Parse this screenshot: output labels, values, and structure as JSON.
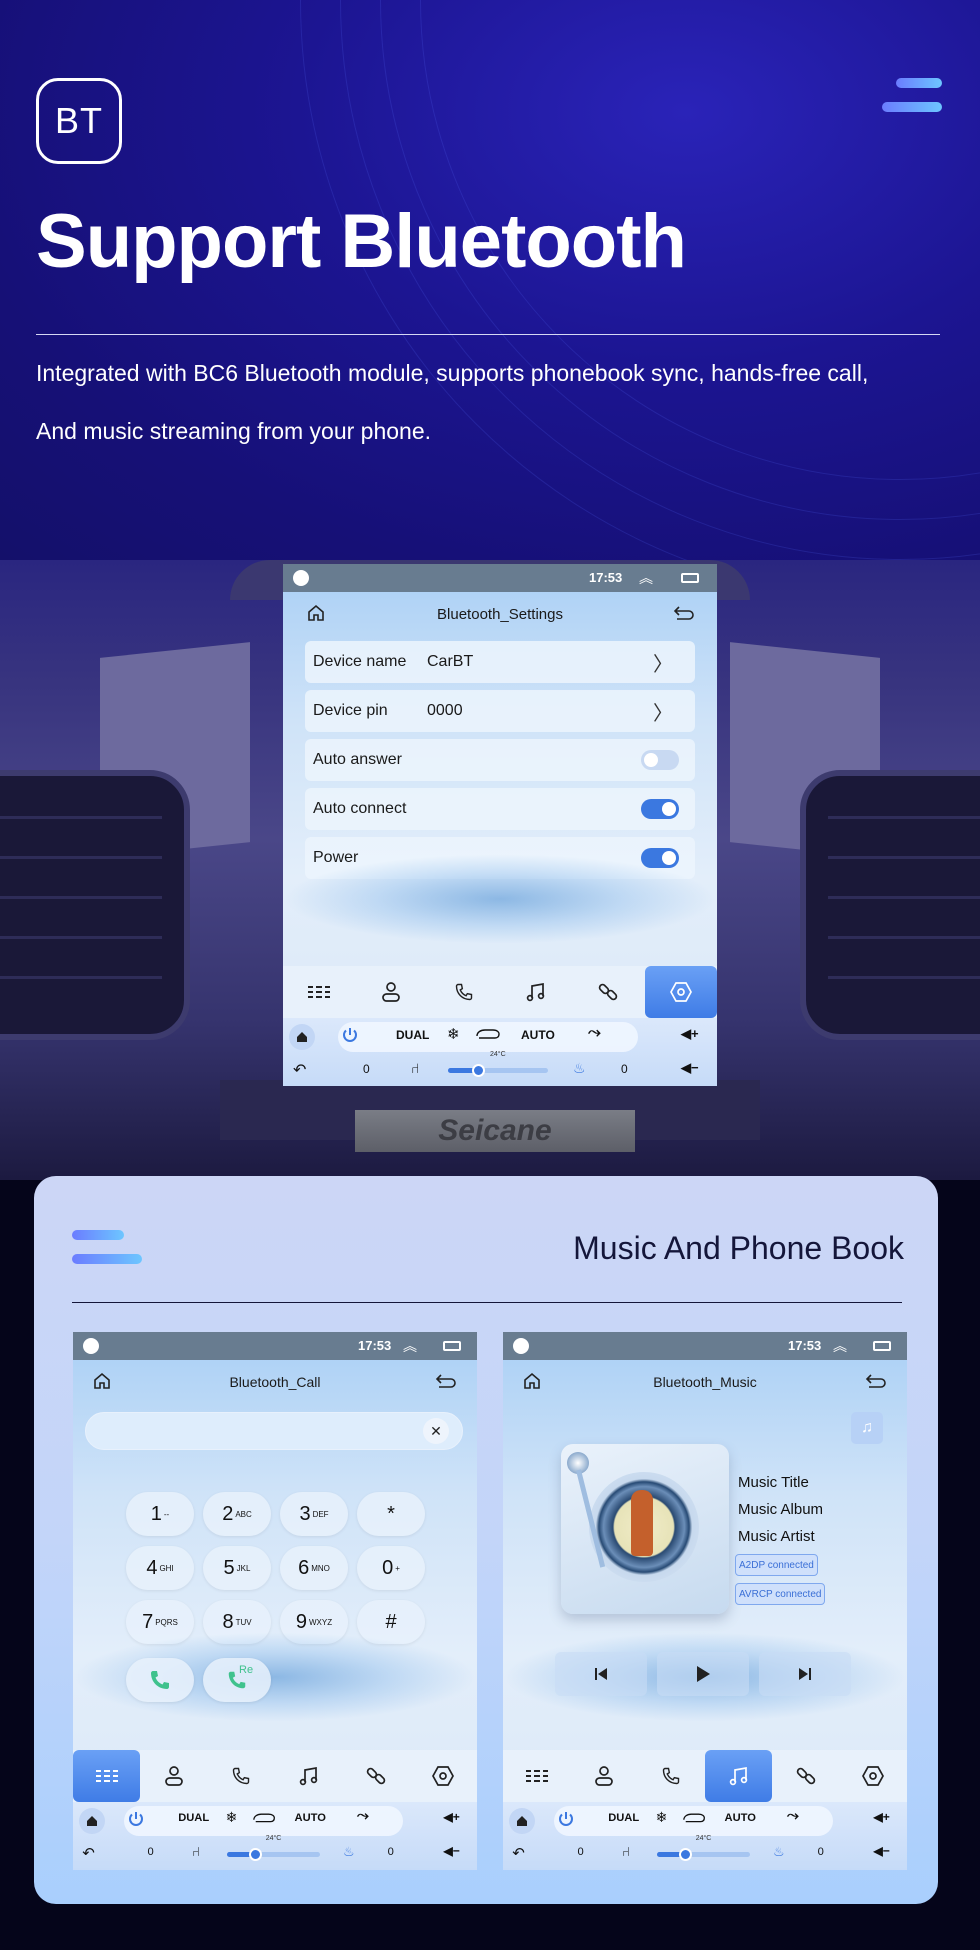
{
  "hero": {
    "badge": "BT",
    "title": "Support Bluetooth",
    "description_line1": "Integrated with BC6 Bluetooth module, supports phonebook sync, hands-free call,",
    "description_line2": "And music streaming from your phone."
  },
  "brand": {
    "logo_text": "Seicane",
    "accent_color": "#3b78e0"
  },
  "statusbar": {
    "time": "17:53"
  },
  "settings_screen": {
    "title": "Bluetooth_Settings",
    "rows": [
      {
        "label": "Device name",
        "value": "CarBT",
        "type": "link"
      },
      {
        "label": "Device pin",
        "value": "0000",
        "type": "link"
      },
      {
        "label": "Auto answer",
        "type": "toggle",
        "on": false
      },
      {
        "label": "Auto connect",
        "type": "toggle",
        "on": true
      },
      {
        "label": "Power",
        "type": "toggle",
        "on": true
      }
    ],
    "active_nav": "settings"
  },
  "nav_items": [
    {
      "id": "dialpad",
      "icon": "grid-icon"
    },
    {
      "id": "contacts",
      "icon": "contacts-icon"
    },
    {
      "id": "calls",
      "icon": "phone-icon"
    },
    {
      "id": "music",
      "icon": "music-note-icon"
    },
    {
      "id": "link",
      "icon": "link-icon"
    },
    {
      "id": "settings",
      "icon": "settings-hex-icon"
    }
  ],
  "climate": {
    "dual": "DUAL",
    "auto": "AUTO",
    "temperature": "24°C",
    "left_seat": "0",
    "right_seat": "0",
    "fan_level": 0.3
  },
  "section": {
    "title": "Music And Phone Book"
  },
  "call_screen": {
    "title": "Bluetooth_Call",
    "input_value": "",
    "keys": [
      {
        "digit": "1",
        "sub": "--"
      },
      {
        "digit": "2",
        "sub": "ABC"
      },
      {
        "digit": "3",
        "sub": "DEF"
      },
      {
        "digit": "*",
        "sub": ""
      },
      {
        "digit": "4",
        "sub": "GHI"
      },
      {
        "digit": "5",
        "sub": "JKL"
      },
      {
        "digit": "6",
        "sub": "MNO"
      },
      {
        "digit": "0",
        "sub": "+"
      },
      {
        "digit": "7",
        "sub": "PQRS"
      },
      {
        "digit": "8",
        "sub": "TUV"
      },
      {
        "digit": "9",
        "sub": "WXYZ"
      },
      {
        "digit": "#",
        "sub": ""
      }
    ],
    "redial_label": "Re",
    "active_nav": "dialpad"
  },
  "music_screen": {
    "title": "Bluetooth_Music",
    "track_title": "Music Title",
    "album": "Music Album",
    "artist": "Music Artist",
    "badges": [
      "A2DP connected",
      "AVRCP connected"
    ],
    "active_nav": "music"
  }
}
